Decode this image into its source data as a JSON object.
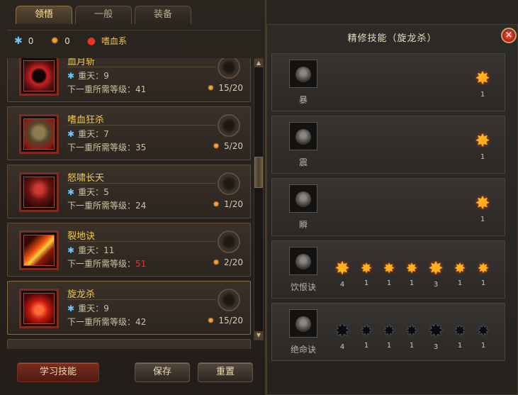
{
  "tabs": [
    "领悟",
    "一般",
    "装备"
  ],
  "resources": {
    "blue_count": "0",
    "orange_count": "0",
    "school_label": "嗜血系"
  },
  "skills": [
    {
      "name": "血月斩",
      "level_label": "重天：9",
      "req_label": "下一重所需等级：",
      "req_value": "41",
      "req_red": false,
      "progress": "15/20"
    },
    {
      "name": "嗜血狂杀",
      "level_label": "重天：7",
      "req_label": "下一重所需等级：",
      "req_value": "35",
      "req_red": false,
      "progress": "5/20"
    },
    {
      "name": "怒啸长天",
      "level_label": "重天：5",
      "req_label": "下一重所需等级：",
      "req_value": "24",
      "req_red": false,
      "progress": "1/20"
    },
    {
      "name": "裂地诀",
      "level_label": "重天：11",
      "req_label": "下一重所需等级：",
      "req_value": "51",
      "req_red": true,
      "progress": "2/20"
    },
    {
      "name": "旋龙杀",
      "level_label": "重天：9",
      "req_label": "下一重所需等级：",
      "req_value": "42",
      "req_red": false,
      "progress": "15/20"
    }
  ],
  "buttons": {
    "learn": "学习技能",
    "save": "保存",
    "reset": "重置"
  },
  "panel": {
    "title": "精修技能（旋龙杀）",
    "close": "×",
    "rows": [
      {
        "label": "暴",
        "stars": [
          {
            "type": "gold",
            "count": "1"
          }
        ]
      },
      {
        "label": "震",
        "stars": [
          {
            "type": "gold",
            "count": "1"
          }
        ]
      },
      {
        "label": "瞬",
        "stars": [
          {
            "type": "gold",
            "count": "1"
          }
        ]
      },
      {
        "label": "饮恨诀",
        "stars": [
          {
            "type": "gold",
            "count": "4"
          },
          {
            "type": "gold-small",
            "count": "1"
          },
          {
            "type": "gold-small",
            "count": "1"
          },
          {
            "type": "gold-small",
            "count": "1"
          },
          {
            "type": "gold",
            "count": "3"
          },
          {
            "type": "gold-small",
            "count": "1"
          },
          {
            "type": "gold-small",
            "count": "1"
          }
        ]
      },
      {
        "label": "绝命诀",
        "stars": [
          {
            "type": "dark",
            "count": "4"
          },
          {
            "type": "dark-small",
            "count": "1"
          },
          {
            "type": "dark-small",
            "count": "1"
          },
          {
            "type": "dark-small",
            "count": "1"
          },
          {
            "type": "dark",
            "count": "3"
          },
          {
            "type": "dark-small",
            "count": "1"
          },
          {
            "type": "dark-small",
            "count": "1"
          }
        ]
      }
    ]
  }
}
